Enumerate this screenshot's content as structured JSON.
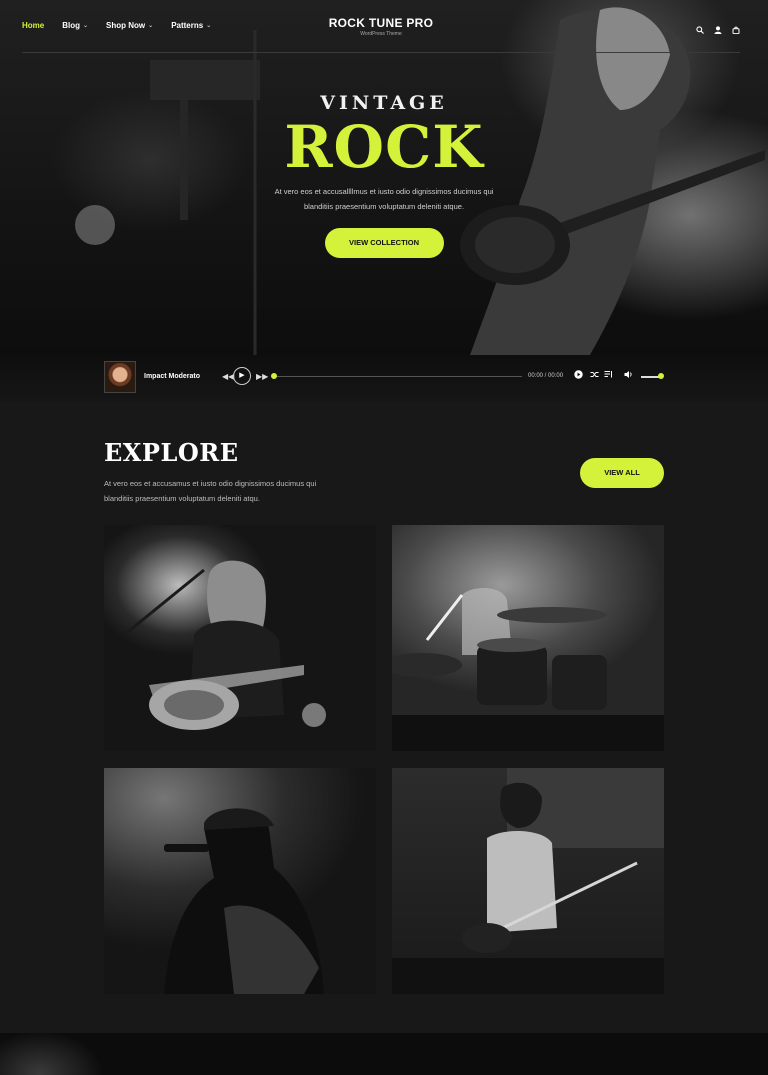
{
  "header": {
    "brand_title": "ROCK TUNE PRO",
    "brand_subtitle": "WordPress Theme",
    "nav": [
      {
        "label": "Home",
        "active": true
      },
      {
        "label": "Blog",
        "dropdown": true
      },
      {
        "label": "Shop Now",
        "dropdown": true
      },
      {
        "label": "Patterns",
        "dropdown": true
      }
    ],
    "icons": [
      "search-icon",
      "user-icon",
      "cart-icon"
    ]
  },
  "hero": {
    "eyebrow": "VINTAGE",
    "title": "ROCK",
    "text": "At vero eos et accusallllmus et iusto odio dignissimos ducimus qui blanditiis praesentium voluptatum deleniti atque.",
    "button": "VIEW COLLECTION"
  },
  "player": {
    "track_title": "Impact Moderato",
    "time": "00:00 / 00:00",
    "icons": [
      "rewind-icon",
      "play-icon",
      "forward-icon",
      "play-circle-icon",
      "shuffle-icon",
      "playlist-icon",
      "volume-icon"
    ]
  },
  "explore": {
    "title": "EXPLORE",
    "text": "At vero eos et accusamus et iusto odio dignissimos ducimus qui blanditiis praesentium voluptatum deleniti atqu.",
    "button": "VIEW ALL",
    "photos": [
      "guitarist-photo",
      "drummer-photo",
      "singer-photo",
      "bassist-photo"
    ]
  },
  "colors": {
    "accent": "#d4f23a",
    "background": "#181818",
    "text": "#ffffff"
  }
}
